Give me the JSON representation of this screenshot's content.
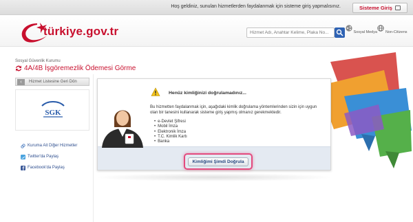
{
  "topbar": {
    "welcome": "Hoş geldiniz, sunulan hizmetlerden faydalanmak için sisteme giriş yapmalısınız.",
    "login_label": "Sisteme Giriş"
  },
  "header": {
    "logo_text": "türkiye.gov.tr",
    "search_placeholder": "Hizmet Adı, Anahtar Kelime, Plaka No...",
    "social_label": "Sosyal Medya",
    "noncitizens_label": "Non-Citizens"
  },
  "breadcrumb": "Sosyal Güvenlik Kurumu",
  "page_title": "4A/4B İşgöremezlik Ödemesi Görme",
  "sidebar": {
    "back_label": "Hizmet Listesine Geri Dön",
    "logo_text": "SGK",
    "links": [
      {
        "label": "Kuruma Ait Diğer Hizmetler",
        "icon": "link-icon"
      },
      {
        "label": "Twitter'da Paylaş",
        "icon": "twitter-icon"
      },
      {
        "label": "Facebook'da Paylaş",
        "icon": "facebook-icon"
      }
    ]
  },
  "panel": {
    "title": "Henüz kimliğinizi doğrulamadınız...",
    "text": "Bu hizmetten faydalanmak için, aşağıdaki kimlik doğrulama yöntemlerinden sizin için uygun olan bir tanesini kullanarak sisteme giriş yapmış olmanız gerekmektedir.",
    "methods": [
      "e-Devlet Şifresi",
      "Mobil İmza",
      "Elektronik İmza",
      "T.C. Kimlik Kartı",
      "Banka"
    ],
    "verify_label": "Kimliğimi Şimdi Doğrula"
  },
  "colors": {
    "brand_red": "#c8102e",
    "link_blue": "#2f4f8f",
    "highlight_pink": "#e34a7e"
  }
}
